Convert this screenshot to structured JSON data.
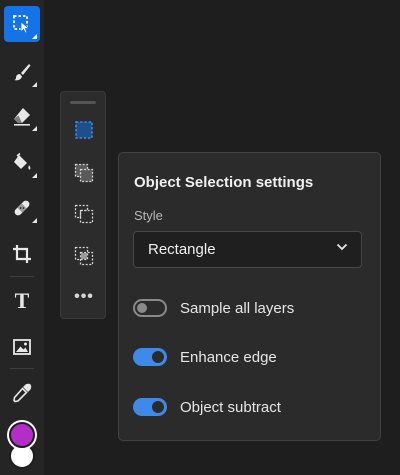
{
  "colors": {
    "accent": "#1473e6",
    "foreground_color": "#b22ec7",
    "background_color": "#ffffff",
    "toggle_on": "#3f8ae8"
  },
  "toolbar": {
    "tools": [
      {
        "name": "selection-tool",
        "icon": "object-selection-icon",
        "active": true
      },
      {
        "name": "brush-tool",
        "icon": "brush-icon",
        "active": false
      },
      {
        "name": "eraser-tool",
        "icon": "eraser-icon",
        "active": false
      },
      {
        "name": "paint-bucket-tool",
        "icon": "paint-bucket-icon",
        "active": false
      },
      {
        "name": "healing-tool",
        "icon": "bandage-icon",
        "active": false
      },
      {
        "name": "crop-tool",
        "icon": "crop-icon",
        "active": false
      },
      {
        "name": "text-tool",
        "icon": "text-icon",
        "glyph": "T",
        "active": false
      },
      {
        "name": "image-tool",
        "icon": "image-icon",
        "active": false
      },
      {
        "name": "eyedropper-tool",
        "icon": "eyedropper-icon",
        "active": false
      }
    ]
  },
  "selection_subtools": [
    {
      "name": "rectangle-marquee",
      "icon": "rectangle-marquee-icon",
      "active": true
    },
    {
      "name": "add-to-selection",
      "icon": "add-selection-icon",
      "active": false
    },
    {
      "name": "subtract-from-selection",
      "icon": "subtract-selection-icon",
      "active": false
    },
    {
      "name": "intersect-selection",
      "icon": "intersect-selection-icon",
      "active": false
    },
    {
      "name": "more-options",
      "icon": "more-icon",
      "glyph": "•••",
      "active": false
    }
  ],
  "settings": {
    "title": "Object Selection settings",
    "style_label": "Style",
    "style_value": "Rectangle",
    "toggles": [
      {
        "label": "Sample all layers",
        "on": false
      },
      {
        "label": "Enhance edge",
        "on": true
      },
      {
        "label": "Object subtract",
        "on": true
      }
    ]
  }
}
